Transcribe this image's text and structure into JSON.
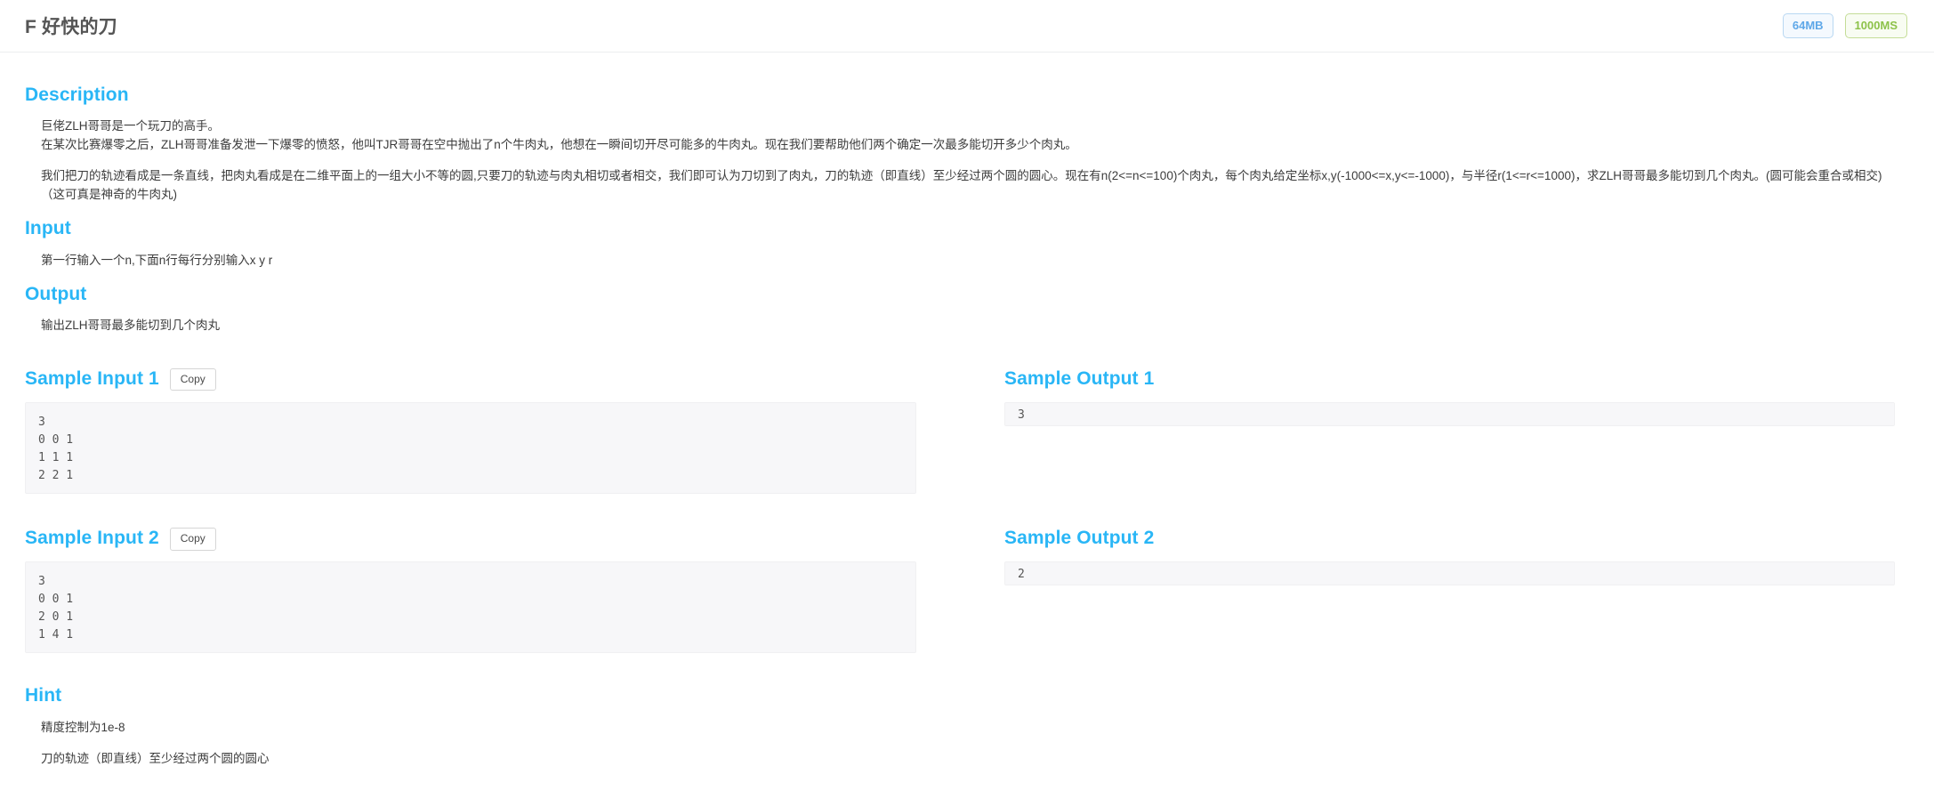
{
  "header": {
    "title": "F 好快的刀",
    "badges": [
      {
        "label": "64MB",
        "kind": "memory",
        "color": "#5fa8e8"
      },
      {
        "label": "1000MS",
        "kind": "time",
        "color": "#8dc24a"
      }
    ]
  },
  "theme": {
    "heading_color": "#29b6f6",
    "title_color": "#555555",
    "body_color": "#3c3c3c",
    "code_background": "#f7f7f9"
  },
  "sections": {
    "description": {
      "heading": "Description",
      "paragraph_1": "巨佬ZLH哥哥是一个玩刀的高手。\n在某次比赛爆零之后，ZLH哥哥准备发泄一下爆零的愤怒，他叫TJR哥哥在空中抛出了n个牛肉丸，他想在一瞬间切开尽可能多的牛肉丸。现在我们要帮助他们两个确定一次最多能切开多少个肉丸。",
      "paragraph_2": "我们把刀的轨迹看成是一条直线，把肉丸看成是在二维平面上的一组大小不等的圆,只要刀的轨迹与肉丸相切或者相交，我们即可认为刀切到了肉丸，刀的轨迹（即直线）至少经过两个圆的圆心。现在有n(2<=n<=100)个肉丸，每个肉丸给定坐标x,y(-1000<=x,y<=-1000)，与半径r(1<=r<=1000)，求ZLH哥哥最多能切到几个肉丸。(圆可能会重合或相交)　（这可真是神奇的牛肉丸)"
    },
    "input": {
      "heading": "Input",
      "text": "第一行输入一个n,下面n行每行分别输入x y r"
    },
    "output": {
      "heading": "Output",
      "text": "输出ZLH哥哥最多能切到几个肉丸"
    },
    "sample_input_1": {
      "heading": "Sample Input 1",
      "copy_label": "Copy",
      "code": "3\n0 0 1\n1 1 1\n2 2 1"
    },
    "sample_output_1": {
      "heading": "Sample Output 1",
      "code": "3"
    },
    "sample_input_2": {
      "heading": "Sample Input 2",
      "copy_label": "Copy",
      "code": "3\n0 0 1\n2 0 1\n1 4 1"
    },
    "sample_output_2": {
      "heading": "Sample Output 2",
      "code": "2"
    },
    "hint": {
      "heading": "Hint",
      "line_1": "精度控制为1e-8",
      "line_2": "刀的轨迹（即直线）至少经过两个圆的圆心"
    }
  }
}
